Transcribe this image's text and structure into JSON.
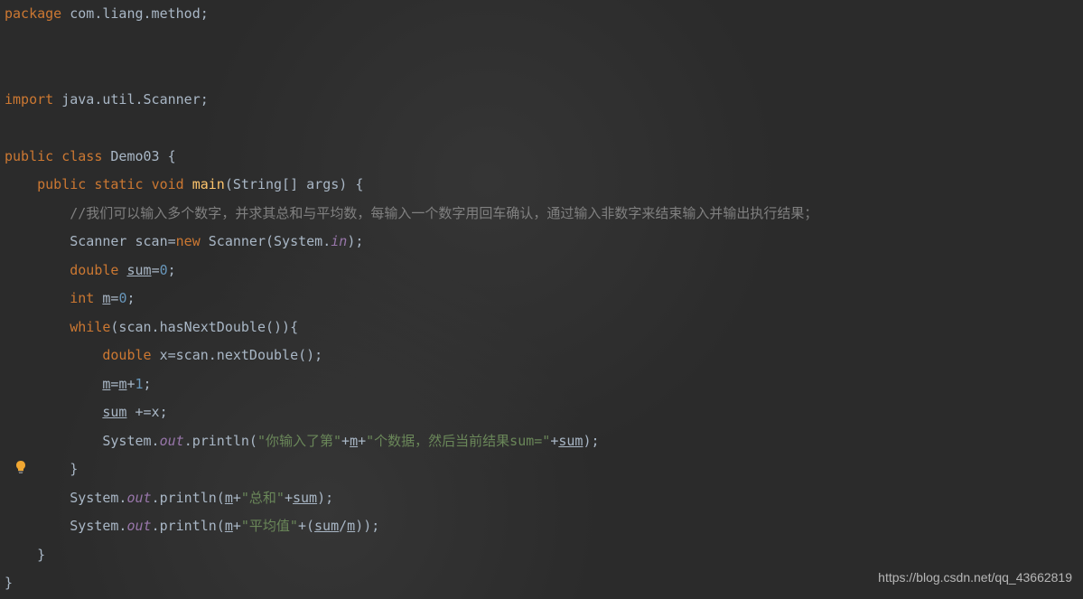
{
  "code": {
    "pkg_kw": "package",
    "pkg_name": " com.liang.method",
    "imp_kw": "import",
    "imp_name": " java.util.Scanner",
    "public": "public",
    "class_kw": "class",
    "class_name": "Demo03",
    "static": "static",
    "void": "void",
    "main": "main",
    "main_params": "(String[] args) {",
    "comment": "//我们可以输入多个数字，并求其总和与平均数，每输入一个数字用回车确认，通过输入非数字来结束输入并输出执行结果；",
    "scanner_type": "Scanner scan=",
    "new_kw": "new",
    "scanner_new": " Scanner(System.",
    "in": "in",
    "close_paren_semi": ");",
    "double": "double",
    "sum": "sum",
    "eq_zero": "=",
    "zero": "0",
    "semi": ";",
    "int": "int",
    "m": "m",
    "while": "while",
    "while_cond": "(scan.hasNextDouble()){",
    "x_decl": " x=scan.nextDouble();",
    "m_eq": "=",
    "plus": "+",
    "one": "1",
    "sum_pe": " +=x;",
    "sys": "System.",
    "out": "out",
    "println": ".println(",
    "str1": "\"你输入了第\"",
    "str2": "\"个数据，然后当前结果sum=\"",
    "close_brace": "}",
    "str_sum": "\"总和\"",
    "str_avg": "\"平均值\"",
    "plus_open": "+(",
    "slash": "/",
    "close2": "));"
  },
  "watermark": "https://blog.csdn.net/qq_43662819"
}
